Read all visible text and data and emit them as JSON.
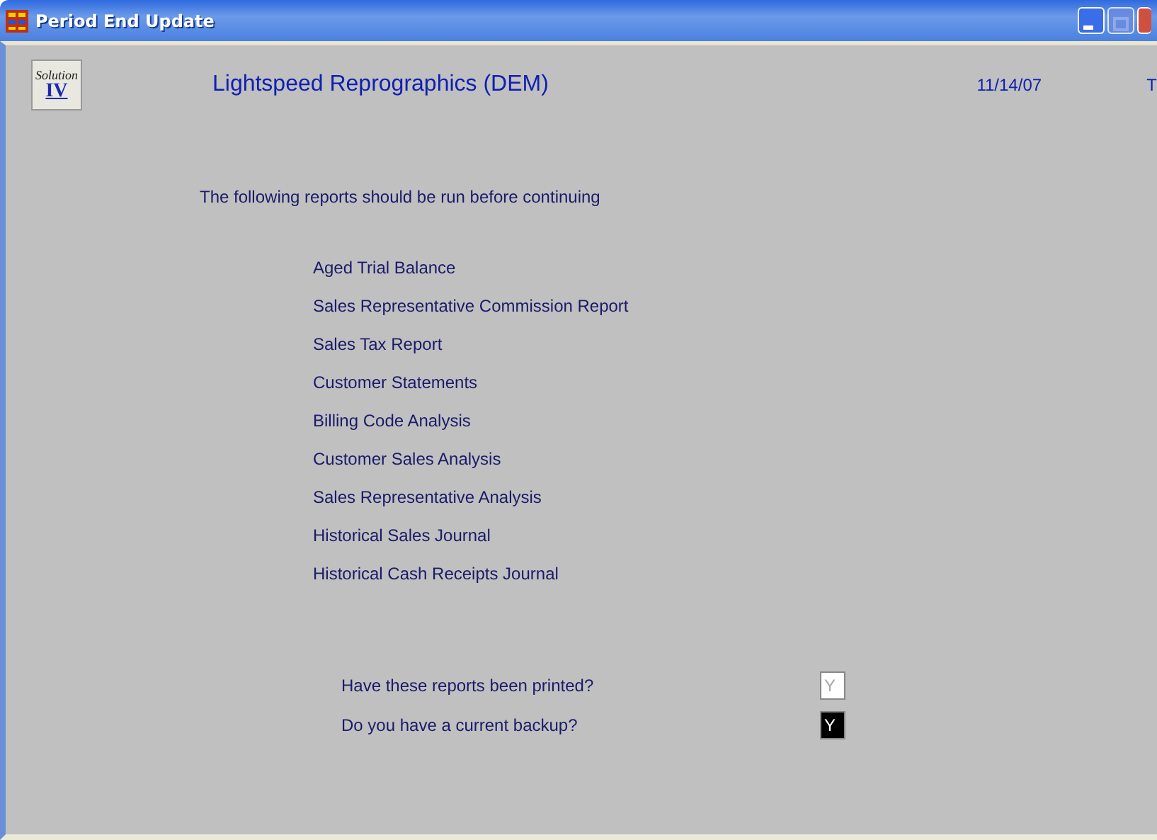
{
  "window": {
    "title": "Period End Update"
  },
  "header": {
    "logo_text": "Solution",
    "logo_numeral": "IV",
    "company": "Lightspeed Reprographics (DEM)",
    "date": "11/14/07",
    "cut_text": "T"
  },
  "intro": "The following reports should be run before continuing",
  "reports": [
    "Aged Trial Balance",
    "Sales Representative Commission Report",
    "Sales Tax Report",
    "Customer Statements",
    "Billing Code Analysis",
    "Customer Sales Analysis",
    "Sales Representative Analysis",
    "Historical Sales Journal",
    "Historical Cash Receipts Journal"
  ],
  "questions": [
    {
      "label": "Have these reports been printed?",
      "value": "Y",
      "focused": false
    },
    {
      "label": "Do you have a current backup?",
      "value": "Y",
      "focused": true
    }
  ]
}
